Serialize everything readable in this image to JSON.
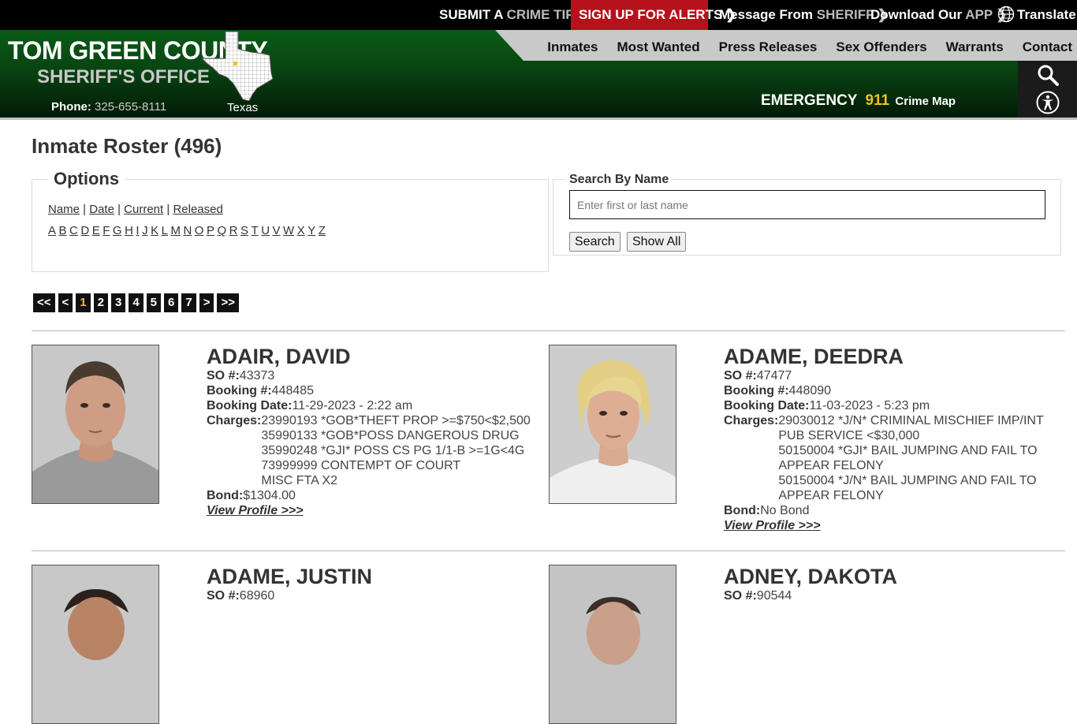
{
  "topbar": {
    "crime_tip": {
      "a": "SUBMIT A",
      "b": "CRIME TIP"
    },
    "alerts": "SIGN UP FOR ALERTS",
    "message": {
      "a": "Message From",
      "b": "SHERIFF"
    },
    "download": {
      "a": "Download Our",
      "b": "APP"
    },
    "translate": "Translate",
    "chevron": "❯"
  },
  "header": {
    "brand_line1": "TOM GREEN COUNTY",
    "brand_line2": "SHERIFF'S OFFICE",
    "phone_label": "Phone:",
    "phone_number": "325-655-8111",
    "state_label": "Texas",
    "nav": [
      "Inmates",
      "Most Wanted",
      "Press Releases",
      "Sex Offenders",
      "Warrants",
      "Contact"
    ],
    "emergency_label": "EMERGENCY",
    "emergency_number": "911",
    "crime_map": "Crime Map"
  },
  "colors": {
    "brand_green": "#0b5c17",
    "alert_red": "#b5121b",
    "highlight_yellow": "#f0c419"
  },
  "page": {
    "title": "Inmate Roster (496)",
    "options_legend": "Options",
    "sort_links": [
      "Name",
      "Date",
      "Current",
      "Released"
    ],
    "letters": [
      "A",
      "B",
      "C",
      "D",
      "E",
      "F",
      "G",
      "H",
      "I",
      "J",
      "K",
      "L",
      "M",
      "N",
      "O",
      "P",
      "Q",
      "R",
      "S",
      "T",
      "U",
      "V",
      "W",
      "X",
      "Y",
      "Z"
    ],
    "search_legend": "Search By Name",
    "search_placeholder": "Enter first or last name",
    "search_button": "Search",
    "show_all_button": "Show All",
    "pager": [
      "<<",
      "<",
      "1",
      "2",
      "3",
      "4",
      "5",
      "6",
      "7",
      ">",
      ">>"
    ],
    "current_page": "1"
  },
  "labels": {
    "so": "SO #:",
    "booking": "Booking #:",
    "booking_date": "Booking Date:",
    "charges": "Charges:",
    "bond": "Bond:",
    "view_profile": "View Profile >>>"
  },
  "inmates": [
    {
      "name": "ADAIR, DAVID",
      "so": "43373",
      "booking": "448485",
      "booking_date": "11-29-2023 - 2:22 am",
      "charges": [
        "23990193 *GOB*THEFT PROP >=$750<$2,500",
        "35990133 *GOB*POSS DANGEROUS DRUG",
        "35990248 *GJI* POSS CS PG 1/1-B >=1G<4G",
        "73999999 CONTEMPT OF COURT",
        "MISC FTA X2"
      ],
      "bond": "$1304.00"
    },
    {
      "name": "ADAME, DEEDRA",
      "so": "47477",
      "booking": "448090",
      "booking_date": "11-03-2023 - 5:23 pm",
      "charges": [
        "29030012 *J/N* CRIMINAL MISCHIEF IMP/INT",
        "PUB SERVICE <$30,000",
        "50150004 *GJI* BAIL JUMPING AND FAIL TO",
        "APPEAR FELONY",
        "50150004 *J/N* BAIL JUMPING AND FAIL TO",
        "APPEAR FELONY"
      ],
      "bond": "No Bond"
    },
    {
      "name": "ADAME, JUSTIN",
      "so": "68960"
    },
    {
      "name": "ADNEY, DAKOTA",
      "so": "90544"
    }
  ]
}
